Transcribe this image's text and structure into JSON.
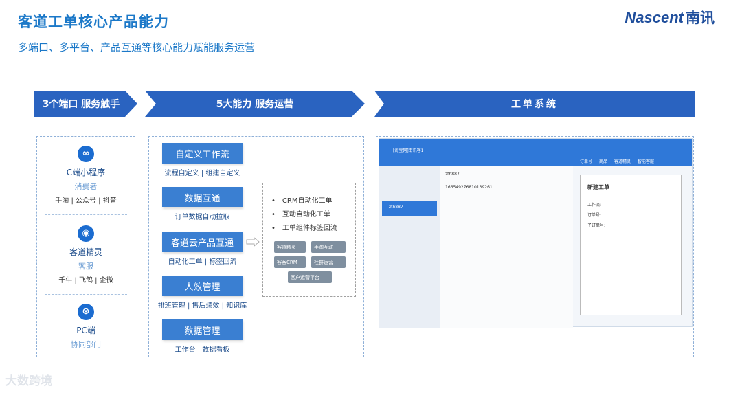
{
  "header": {
    "title": "客道工单核心产品能力",
    "subtitle": "多端口、多平台、产品互通等核心能力赋能服务运营",
    "logo_en": "Nascent",
    "logo_cn": "南讯"
  },
  "banners": {
    "ports": "3个端口 服务触手",
    "abilities": "5大能力 服务运营",
    "system": "工单系统"
  },
  "endpoints": [
    {
      "icon": "mini-program-icon",
      "name": "C端小程序",
      "role": "消费者",
      "channels": "手淘 | 公众号 | 抖音"
    },
    {
      "icon": "droplet-icon",
      "name": "客道精灵",
      "role": "客服",
      "channels": "千牛 | 飞鸽 | 企微"
    },
    {
      "icon": "link-icon",
      "name": "PC端",
      "role": "协同部门",
      "channels": ""
    }
  ],
  "capabilities": [
    {
      "name": "自定义工作流",
      "sub": "流程自定义 | 组建自定义"
    },
    {
      "name": "数据互通",
      "sub": "订单数据自动拉取"
    },
    {
      "name": "客道云产品互通",
      "sub": "自动化工单 | 标签回流"
    },
    {
      "name": "人效管理",
      "sub": "排班管理 | 售后绩效 | 知识库"
    },
    {
      "name": "数据管理",
      "sub": "工作台 | 数据看板"
    }
  ],
  "crm": {
    "items": [
      "CRM自动化工单",
      "互动自动化工单",
      "工单组件标签回流"
    ],
    "chips": [
      "客道精灵",
      "手淘互动",
      "客客CRM",
      "社群运营",
      "客户运营平台"
    ]
  },
  "screenshot": {
    "app_title": "[淘宝网]南讯客1",
    "tabs": [
      "订单号",
      "商品",
      "客道精灵",
      "智能客服"
    ],
    "contact": "zth887",
    "order_no": "166549276810139261",
    "panel_title": "新建工单",
    "panel_fields": [
      "工作流:",
      "订单号:",
      "子订单号:"
    ]
  },
  "watermark": "大数跨境"
}
